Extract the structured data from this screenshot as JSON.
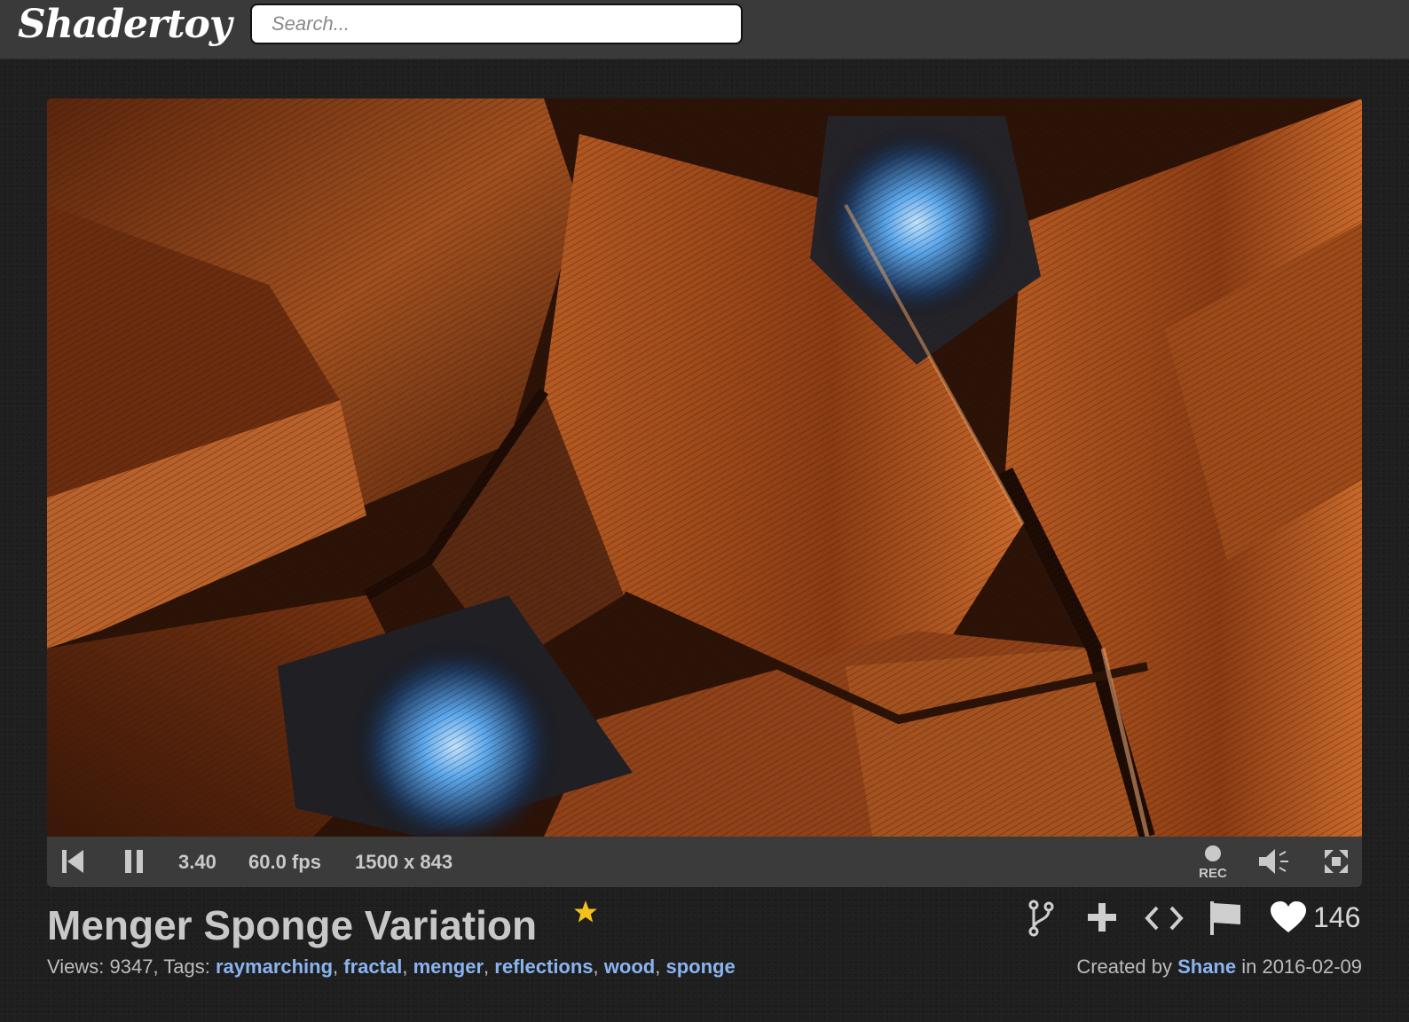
{
  "header": {
    "logo": "Shadertoy",
    "search_placeholder": "Search..."
  },
  "player": {
    "time": "3.40",
    "fps": "60.0 fps",
    "resolution": "1500 x 843",
    "rec_label": "REC",
    "icons": [
      "rewind-icon",
      "pause-icon",
      "record-icon",
      "volume-icon",
      "fullscreen-icon"
    ]
  },
  "shader": {
    "title": "Menger Sponge Variation",
    "views_prefix": "Views: 9347, Tags: ",
    "tags": [
      "raymarching",
      "fractal",
      "menger",
      "reflections",
      "wood",
      "sponge"
    ],
    "credit_prefix": "Created by ",
    "author": "Shane",
    "credit_suffix": " in 2016-02-09",
    "likes": "146",
    "favorite_icon": "star-icon"
  },
  "actions": {
    "icons": [
      "fork-icon",
      "add-icon",
      "code-icon",
      "flag-icon",
      "heart-icon"
    ]
  },
  "colors": {
    "header_bg": "#3a3a3a",
    "page_bg": "#1f1f1f",
    "control_bg": "#3b3b3b",
    "link": "#8ab4f0",
    "star": "#f2c21b",
    "wood": "#9a4a1c",
    "glow": "#6fb6ff"
  }
}
